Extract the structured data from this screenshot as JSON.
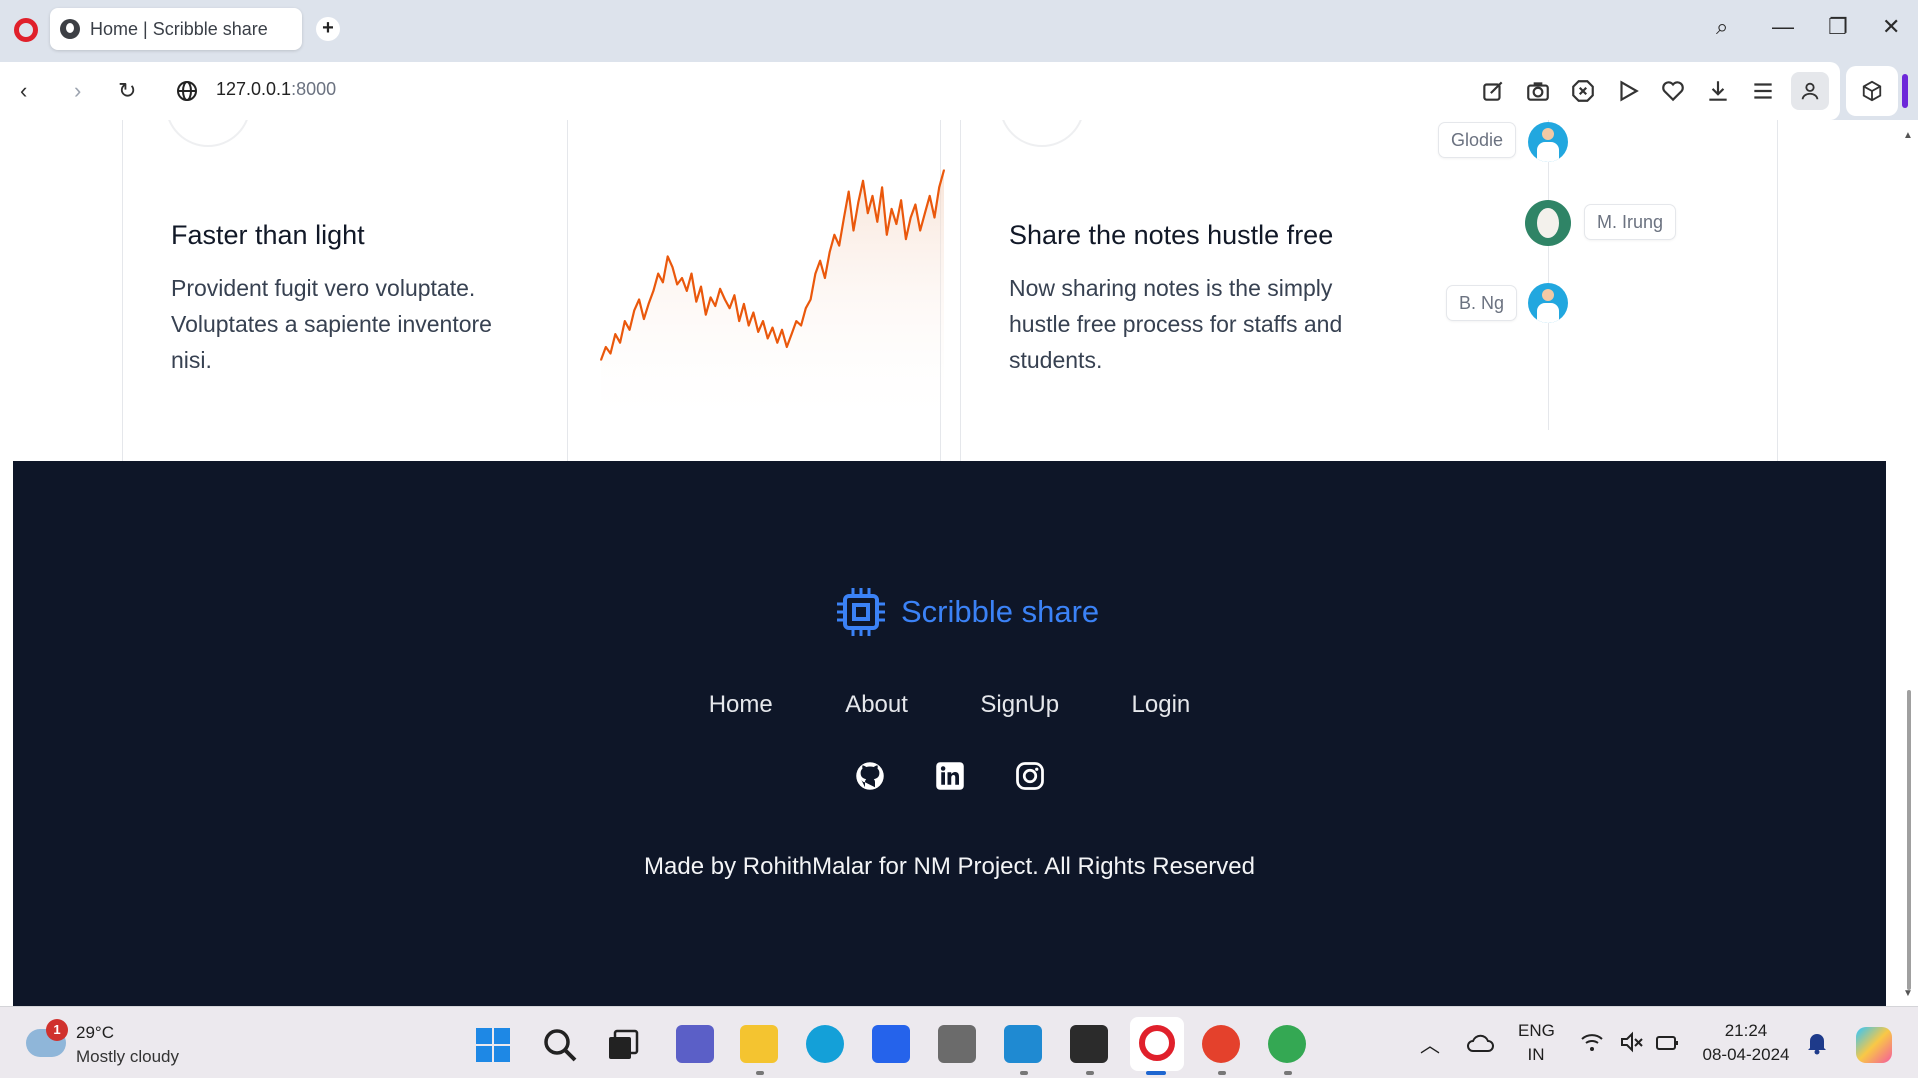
{
  "browser": {
    "tab_title": "Home | Scribble share",
    "new_tab_symbol": "+",
    "url_host": "127.0.0.1",
    "url_port": ":8000",
    "window_controls": {
      "search": "⌕",
      "minimize": "—",
      "restore": "❐",
      "close": "✕"
    },
    "nav": {
      "back": "‹",
      "forward": "›",
      "reload": "↻"
    },
    "toolbar_icons": [
      "edit-icon",
      "camera-icon",
      "adblock-icon",
      "play-icon",
      "heart-icon",
      "download-icon",
      "menu-icon",
      "profile-icon",
      "extensions-icon"
    ]
  },
  "features": [
    {
      "title": "Faster than light",
      "description": "Provident fugit vero voluptate. Voluptates a sapiente inventore nisi."
    },
    {
      "title": "Share the notes hustle free",
      "description": "Now sharing notes is the simply hustle free process for staffs and students."
    }
  ],
  "chart_data": {
    "type": "line",
    "title": "",
    "xlabel": "",
    "ylabel": "",
    "series": [
      {
        "values": [
          12,
          18,
          15,
          24,
          20,
          30,
          26,
          35,
          40,
          31,
          38,
          44,
          52,
          48,
          60,
          55,
          47,
          50,
          44,
          52,
          39,
          46,
          33,
          41,
          37,
          45,
          40,
          36,
          42,
          30,
          38,
          28,
          34,
          25,
          30,
          22,
          27,
          20,
          26,
          18,
          24,
          30,
          28,
          36,
          40,
          52,
          58,
          50,
          62,
          70,
          65,
          78,
          90,
          72,
          85,
          95,
          80,
          88,
          76,
          92,
          70,
          82,
          75,
          86,
          68,
          78,
          84,
          72,
          80,
          88,
          78,
          92,
          100
        ]
      }
    ],
    "color": "#ea580c"
  },
  "timeline": [
    {
      "name": "Glodie",
      "avatar": "person-avatar"
    },
    {
      "name": "M. Irung",
      "avatar": "egg-avatar"
    },
    {
      "name": "B. Ng",
      "avatar": "person-avatar"
    }
  ],
  "footer": {
    "brand": "Scribble share",
    "nav": [
      "Home",
      "About",
      "SignUp",
      "Login"
    ],
    "socials": [
      "github-icon",
      "linkedin-icon",
      "instagram-icon"
    ],
    "copyright": "Made by RohithMalar for NM Project. All Rights Reserved"
  },
  "taskbar": {
    "weather_temp": "29°C",
    "weather_desc": "Mostly cloudy",
    "weather_badge": "1",
    "language": "ENG",
    "region": "IN",
    "time": "21:24",
    "date": "08-04-2024"
  },
  "colors": {
    "footer_bg": "#0e1628",
    "brand_blue": "#3b82f6",
    "chart_orange": "#ea580c"
  }
}
